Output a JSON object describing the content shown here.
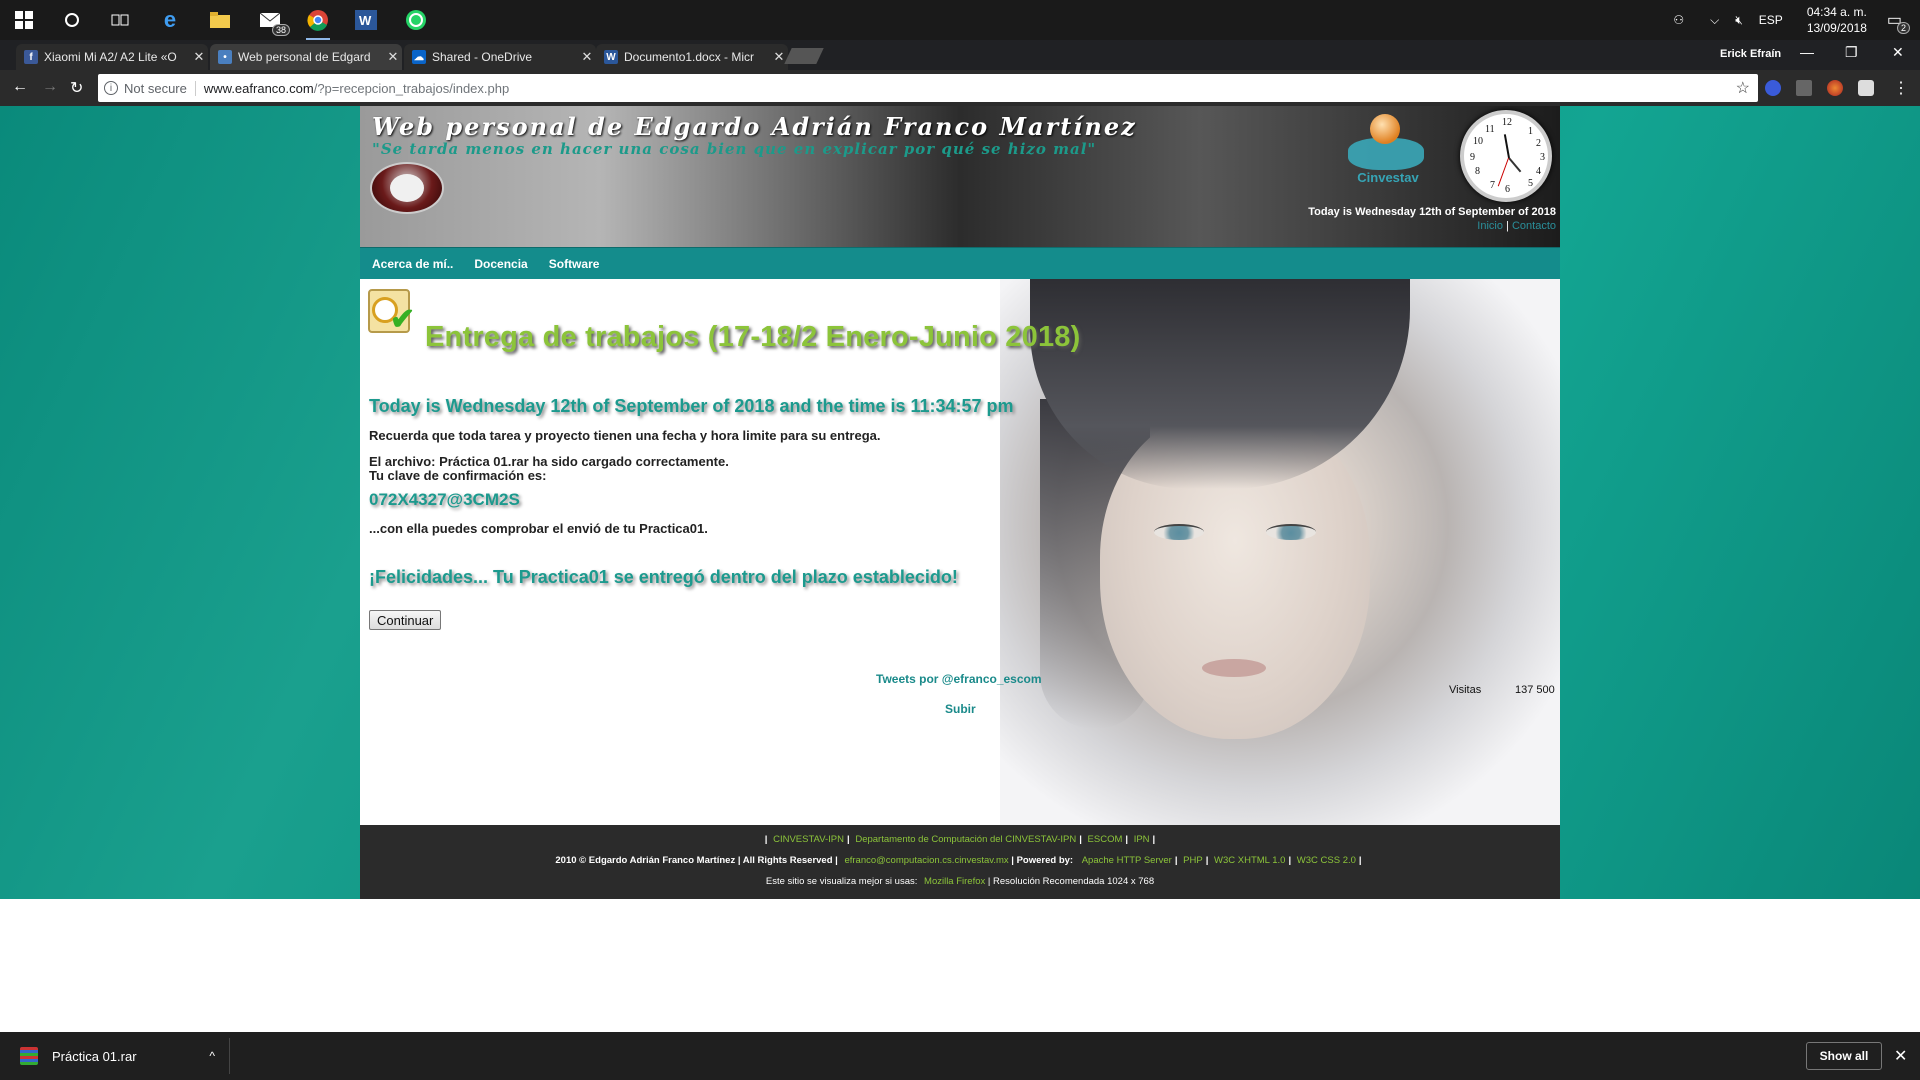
{
  "taskbar": {
    "mail_badge": "38",
    "tray_lang": "ESP",
    "time": "04:34 a. m.",
    "date": "13/09/2018",
    "notif_badge": "2"
  },
  "tabs": [
    {
      "title": "Xiaomi Mi A2/ A2 Lite «O",
      "favicon": "facebook-icon",
      "color": "#3b5998"
    },
    {
      "title": "Web personal de Edgard",
      "favicon": "site-icon",
      "color": "#4a7fbf"
    },
    {
      "title": "Shared - OneDrive",
      "favicon": "onedrive-icon",
      "color": "#0a64c8"
    },
    {
      "title": "Documento1.docx - Micr",
      "favicon": "word-icon",
      "color": "#2b579a"
    }
  ],
  "window": {
    "user": "Erick Efraín"
  },
  "address": {
    "security": "Not secure",
    "host": "www.eafranco.com",
    "path": "/?p=recepcion_trabajos/index.php"
  },
  "banner": {
    "title": "Web personal de Edgardo Adrián Franco Martínez",
    "quote": "\"Se tarda menos en hacer una cosa bien que en explicar por qué se hizo mal\"",
    "cinvestav": "Cinvestav",
    "date": "Today is Wednesday 12th of September of 2018",
    "link_home": "Inicio",
    "link_contact": "Contacto"
  },
  "nav": [
    "Acerca de mí..",
    "Docencia",
    "Software"
  ],
  "content": {
    "heading": "Entrega de trabajos (17-18/2 Enero-Junio 2018)",
    "today": "Today is Wednesday 12th of September of 2018 and the time is 11:34:57 pm",
    "reminder": "Recuerda que toda tarea y proyecto tienen una fecha y hora limite para su entrega.",
    "uploaded": "El archivo: Práctica 01.rar ha sido cargado correctamente.",
    "key_label": "Tu clave de confirmación es:",
    "key": "072X4327@3CM2S",
    "verify": "...con ella puedes comprobar el envió de tu Practica01.",
    "congrats": "¡Felicidades... Tu Practica01 se entregó dentro del plazo establecido!",
    "continue_label": "Continuar",
    "tweets": "Tweets por @efranco_escom",
    "visits_label": "Visitas",
    "visits_value": "137 500",
    "top_link": "Subir"
  },
  "footer": {
    "links1": [
      "CINVESTAV-IPN",
      "Departamento de Computación del CINVESTAV-IPN",
      "ESCOM",
      "IPN"
    ],
    "copyright": "2010 © Edgardo Adrián Franco Martínez | All Rights Reserved |",
    "email": "efranco@computacion.cs.cinvestav.mx",
    "powered": "| Powered by:",
    "links2": [
      "Apache HTTP Server",
      "PHP",
      "W3C XHTML 1.0",
      "W3C CSS 2.0"
    ],
    "best_view": "Este sitio se visualiza mejor si usas:",
    "firefox": "Mozilla Firefox",
    "resolution": "| Resolución Recomendada 1024 x 768"
  },
  "downloads": {
    "file": "Práctica 01.rar",
    "show_all": "Show all"
  }
}
